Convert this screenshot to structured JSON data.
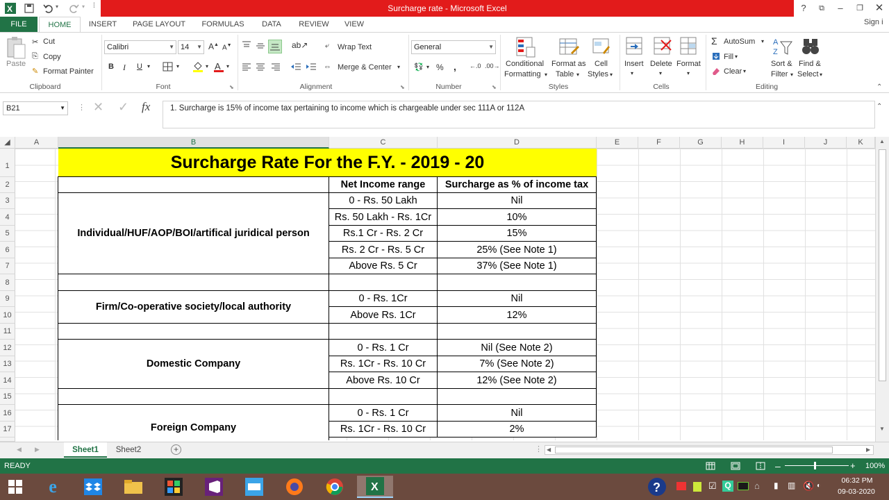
{
  "window": {
    "title": "Surcharge rate - Microsoft Excel",
    "help": "?",
    "signin": "Sign i"
  },
  "tabs": {
    "file": "FILE",
    "items": [
      "HOME",
      "INSERT",
      "PAGE LAYOUT",
      "FORMULAS",
      "DATA",
      "REVIEW",
      "VIEW"
    ]
  },
  "ribbon": {
    "clipboard": {
      "label": "Clipboard",
      "paste": "Paste",
      "cut": "Cut",
      "copy": "Copy",
      "format_painter": "Format Painter"
    },
    "font": {
      "label": "Font",
      "name": "Calibri",
      "size": "14",
      "bold": "B",
      "italic": "I",
      "underline": "U"
    },
    "alignment": {
      "label": "Alignment",
      "wrap_text": "Wrap Text",
      "merge_center": "Merge & Center"
    },
    "number": {
      "label": "Number",
      "format": "General",
      "percent": "%",
      "comma": ","
    },
    "styles": {
      "label": "Styles",
      "conditional": "Conditional",
      "conditional2": "Formatting",
      "format_table": "Format as",
      "format_table2": "Table",
      "cell_styles": "Cell",
      "cell_styles2": "Styles"
    },
    "cells": {
      "label": "Cells",
      "insert": "Insert",
      "delete": "Delete",
      "format": "Format"
    },
    "editing": {
      "label": "Editing",
      "autosum": "AutoSum",
      "fill": "Fill",
      "clear": "Clear",
      "sort": "Sort &",
      "sort2": "Filter",
      "find": "Find &",
      "find2": "Select"
    }
  },
  "formula_bar": {
    "name_box": "B21",
    "fx": "fx",
    "content": "1. Surcharge is 15% of income tax pertaining to income which is chargeable under sec 111A or 112A"
  },
  "columns": [
    "A",
    "B",
    "C",
    "D",
    "E",
    "F",
    "G",
    "H",
    "I",
    "J",
    "K"
  ],
  "rows": [
    "1",
    "2",
    "3",
    "4",
    "5",
    "6",
    "7",
    "8",
    "9",
    "10",
    "11",
    "12",
    "13",
    "14",
    "15",
    "16",
    "17"
  ],
  "sheet": {
    "title": "Surcharge Rate For the F.Y. - 2019 - 20",
    "header_income": "Net Income range",
    "header_surcharge": "Surcharge as % of income tax",
    "cat_individual": "Individual/HUF/AOP/BOI/artifical juridical person",
    "cat_firm": "Firm/Co-operative society/local authority",
    "cat_domestic": "Domestic Company",
    "cat_foreign": "Foreign Company",
    "ind": [
      [
        "0 - Rs. 50 Lakh",
        "Nil"
      ],
      [
        "Rs. 50 Lakh - Rs. 1Cr",
        "10%"
      ],
      [
        "Rs.1 Cr - Rs. 2 Cr",
        "15%"
      ],
      [
        "Rs. 2 Cr - Rs. 5 Cr",
        "25% (See Note 1)"
      ],
      [
        "Above Rs. 5 Cr",
        "37% (See Note 1)"
      ]
    ],
    "firm": [
      [
        "0 - Rs. 1Cr",
        "Nil"
      ],
      [
        "Above Rs. 1Cr",
        "12%"
      ]
    ],
    "dom": [
      [
        "0 - Rs. 1 Cr",
        "Nil (See Note 2)"
      ],
      [
        "Rs. 1Cr - Rs. 10 Cr",
        "7% (See Note 2)"
      ],
      [
        "Above Rs. 10 Cr",
        "12% (See Note 2)"
      ]
    ],
    "for": [
      [
        "0 - Rs. 1 Cr",
        "Nil"
      ],
      [
        "Rs. 1Cr - Rs. 10 Cr",
        "2%"
      ]
    ]
  },
  "sheet_tabs": [
    "Sheet1",
    "Sheet2"
  ],
  "status": {
    "ready": "READY",
    "zoom": "100%"
  },
  "taskbar": {
    "time": "06:32 PM",
    "date": "09-03-2020"
  },
  "colors": {
    "excel_green": "#217346",
    "title_red": "#e21b1b",
    "yellow": "#ffff00"
  }
}
